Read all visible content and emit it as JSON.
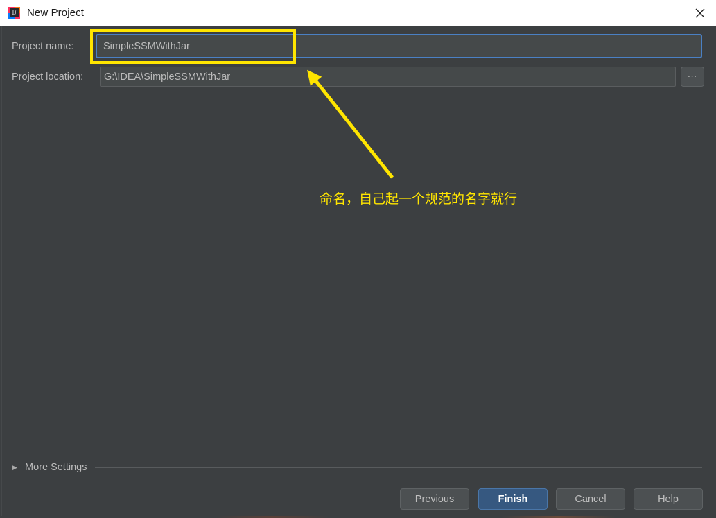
{
  "window": {
    "title": "New Project",
    "icon": "intellij-idea-icon",
    "close_label": "✕"
  },
  "form": {
    "project_name": {
      "label": "Project name:",
      "value": "SimpleSSMWithJar",
      "placeholder": ""
    },
    "project_location": {
      "label": "Project location:",
      "value": "G:\\IDEA\\SimpleSSMWithJar",
      "placeholder": "",
      "browse_label": "..."
    }
  },
  "more_settings": {
    "label": "More Settings",
    "arrow": "▶",
    "expanded": false
  },
  "buttons": {
    "previous": "Previous",
    "finish": "Finish",
    "cancel": "Cancel",
    "help": "Help"
  },
  "annotations": {
    "highlight_color": "#ffe500",
    "note_text": "命名，自己起一个规范的名字就行"
  },
  "colors": {
    "dialog_background": "#3c3f41",
    "titlebar_background": "#ffffff",
    "input_background": "#45494a",
    "focus_border": "#4a80c4",
    "primary_button": "#365880",
    "annotation_yellow": "#ffe500",
    "label_text": "#bbbbbb"
  }
}
